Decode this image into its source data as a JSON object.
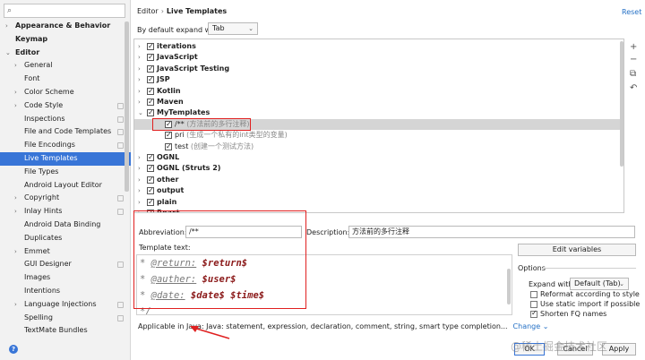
{
  "sidebar": {
    "search_placeholder": "",
    "items": [
      {
        "label": "Appearance & Behavior",
        "level": 0,
        "arrow": "›",
        "bold": true
      },
      {
        "label": "Keymap",
        "level": 0,
        "arrow": "",
        "bold": true
      },
      {
        "label": "Editor",
        "level": 0,
        "arrow": "⌄",
        "bold": true
      },
      {
        "label": "General",
        "level": 1,
        "arrow": "›"
      },
      {
        "label": "Font",
        "level": 1,
        "arrow": ""
      },
      {
        "label": "Color Scheme",
        "level": 1,
        "arrow": "›"
      },
      {
        "label": "Code Style",
        "level": 1,
        "arrow": "›",
        "copy": true
      },
      {
        "label": "Inspections",
        "level": 1,
        "arrow": "",
        "copy": true
      },
      {
        "label": "File and Code Templates",
        "level": 1,
        "arrow": "",
        "copy": true
      },
      {
        "label": "File Encodings",
        "level": 1,
        "arrow": "",
        "copy": true
      },
      {
        "label": "Live Templates",
        "level": 1,
        "arrow": "",
        "selected": true
      },
      {
        "label": "File Types",
        "level": 1,
        "arrow": ""
      },
      {
        "label": "Android Layout Editor",
        "level": 1,
        "arrow": ""
      },
      {
        "label": "Copyright",
        "level": 1,
        "arrow": "›",
        "copy": true
      },
      {
        "label": "Inlay Hints",
        "level": 1,
        "arrow": "›",
        "copy": true
      },
      {
        "label": "Android Data Binding",
        "level": 1,
        "arrow": ""
      },
      {
        "label": "Duplicates",
        "level": 1,
        "arrow": ""
      },
      {
        "label": "Emmet",
        "level": 1,
        "arrow": "›"
      },
      {
        "label": "GUI Designer",
        "level": 1,
        "arrow": "",
        "copy": true
      },
      {
        "label": "Images",
        "level": 1,
        "arrow": ""
      },
      {
        "label": "Intentions",
        "level": 1,
        "arrow": ""
      },
      {
        "label": "Language Injections",
        "level": 1,
        "arrow": "›",
        "copy": true
      },
      {
        "label": "Spelling",
        "level": 1,
        "arrow": "",
        "copy": true
      },
      {
        "label": "TextMate Bundles",
        "level": 1,
        "arrow": ""
      }
    ],
    "help": "?"
  },
  "header": {
    "crumb_parent": "Editor",
    "crumb_sep": "›",
    "crumb_current": "Live Templates",
    "reset": "Reset",
    "expand_label": "By default expand with",
    "expand_value": "Tab"
  },
  "tree": {
    "rows": [
      {
        "label": "iterations",
        "level": 0,
        "arrow": "›",
        "bold": true
      },
      {
        "label": "JavaScript",
        "level": 0,
        "arrow": "›",
        "bold": true
      },
      {
        "label": "JavaScript Testing",
        "level": 0,
        "arrow": "›",
        "bold": true
      },
      {
        "label": "JSP",
        "level": 0,
        "arrow": "›",
        "bold": true
      },
      {
        "label": "Kotlin",
        "level": 0,
        "arrow": "›",
        "bold": true
      },
      {
        "label": "Maven",
        "level": 0,
        "arrow": "›",
        "bold": true
      },
      {
        "label": "MyTemplates",
        "level": 0,
        "arrow": "⌄",
        "bold": true
      },
      {
        "label": "/**",
        "desc": " (方法前的多行注释)",
        "level": 1,
        "highlight": true
      },
      {
        "label": "pri",
        "desc": " (生成一个私有的int类型的变量)",
        "level": 1
      },
      {
        "label": "test",
        "desc": " (创建一个测试方法)",
        "level": 1
      },
      {
        "label": "OGNL",
        "level": 0,
        "arrow": "›",
        "bold": true
      },
      {
        "label": "OGNL (Struts 2)",
        "level": 0,
        "arrow": "›",
        "bold": true
      },
      {
        "label": "other",
        "level": 0,
        "arrow": "›",
        "bold": true
      },
      {
        "label": "output",
        "level": 0,
        "arrow": "›",
        "bold": true
      },
      {
        "label": "plain",
        "level": 0,
        "arrow": "›",
        "bold": true
      },
      {
        "label": "React",
        "level": 0,
        "arrow": "›",
        "bold": true
      }
    ],
    "toolbar": [
      "+",
      "−",
      "⧉",
      "↶"
    ]
  },
  "editor": {
    "abbr_label": "Abbreviation:",
    "abbr_value": "/**",
    "desc_label": "Description:",
    "desc_value": "方法前的多行注释",
    "template_label": "Template text:",
    "lines": [
      {
        "star": "* ",
        "tag": "@return:",
        "var": " $return$"
      },
      {
        "star": "* ",
        "tag": "@auther:",
        "var": " $user$"
      },
      {
        "star": "* ",
        "tag": "@date:",
        "var": " $date$ $time$"
      },
      {
        "star": "*/",
        "tag": "",
        "var": ""
      }
    ],
    "edit_variables": "Edit variables",
    "options_title": "Options",
    "expand_with_label": "Expand with",
    "expand_with_value": "Default (Tab)",
    "options": [
      {
        "label": "Reformat according to style",
        "checked": false
      },
      {
        "label": "Use static import if possible",
        "checked": false
      },
      {
        "label": "Shorten FQ names",
        "checked": true
      }
    ],
    "applicable": "Applicable in Java: Java: statement, expression, declaration, comment, string, smart type completion...",
    "change": "Change ⌄"
  },
  "buttons": {
    "ok": "OK",
    "cancel": "Cancel",
    "apply": "Apply"
  },
  "watermark": "@稀土掘金技术社区",
  "colors": {
    "accent": "#3875d7",
    "annotation_red": "#e02020"
  }
}
